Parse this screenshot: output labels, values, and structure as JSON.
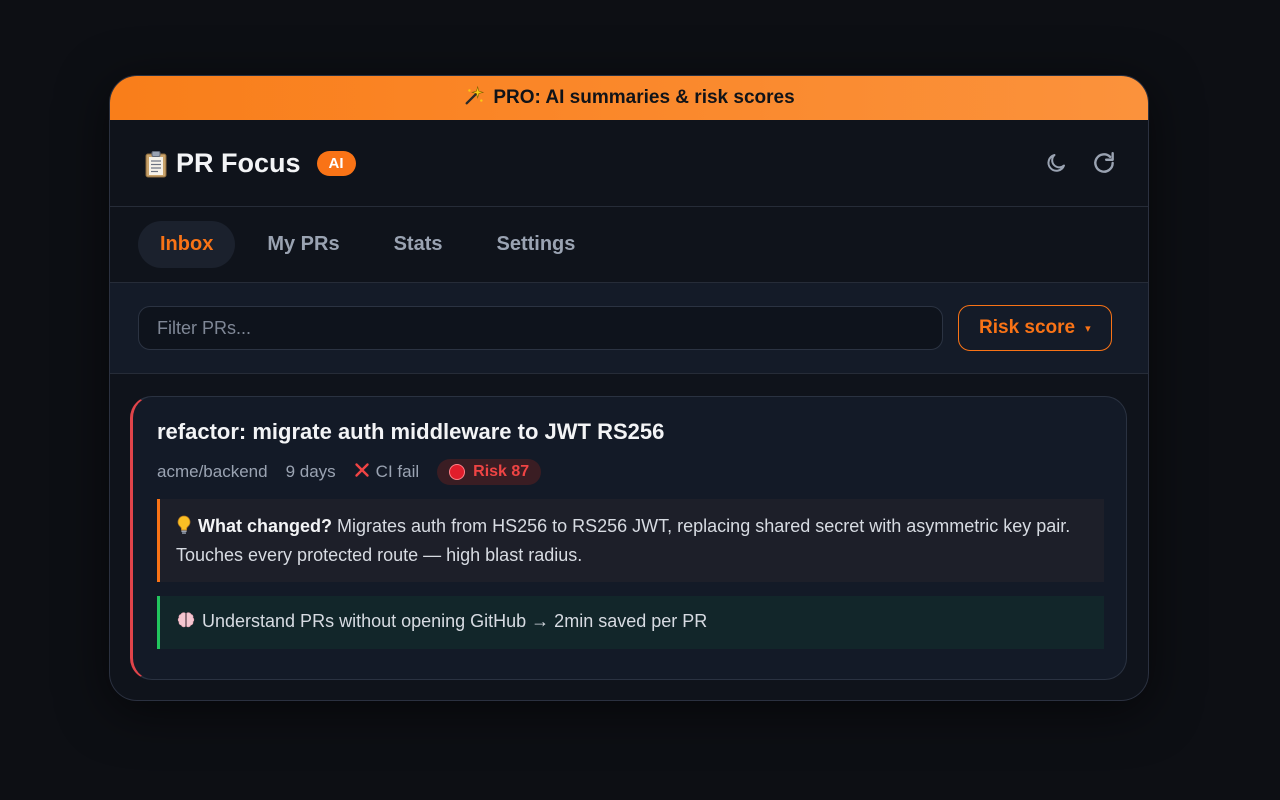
{
  "promo": {
    "icon": "sparkles-icon",
    "text": "PRO: AI summaries & risk scores"
  },
  "header": {
    "logo_icon": "clipboard-icon",
    "title": "PR Focus",
    "badge": "AI",
    "actions": [
      "moon-icon",
      "refresh-icon"
    ]
  },
  "tabs": [
    {
      "label": "Inbox",
      "active": true
    },
    {
      "label": "My PRs",
      "active": false
    },
    {
      "label": "Stats",
      "active": false
    },
    {
      "label": "Settings",
      "active": false
    }
  ],
  "filter": {
    "placeholder": "Filter PRs...",
    "sort_label": "Risk score",
    "sort_caret": "▾"
  },
  "pr_card": {
    "title": "refactor: migrate auth middleware to JWT RS256",
    "repo": "acme/backend",
    "age": "9 days",
    "ci_icon": "x-icon",
    "ci_status": "CI fail",
    "risk_icon": "red-circle-icon",
    "risk_label": "Risk 87",
    "summary_icon": "lightbulb-icon",
    "summary_label": "What changed?",
    "summary_text": "Migrates auth from HS256 to RS256 JWT, replacing shared secret with asymmetric key pair. Touches every protected route — high blast radius.",
    "note_icon": "brain-icon",
    "note_text": "Understand PRs without opening GitHub → 2min saved per PR"
  },
  "colors": {
    "accent": "#f97316",
    "danger": "#ef4444",
    "success": "#22c55e",
    "background": "#0d0f14",
    "panel": "#0f131b"
  }
}
